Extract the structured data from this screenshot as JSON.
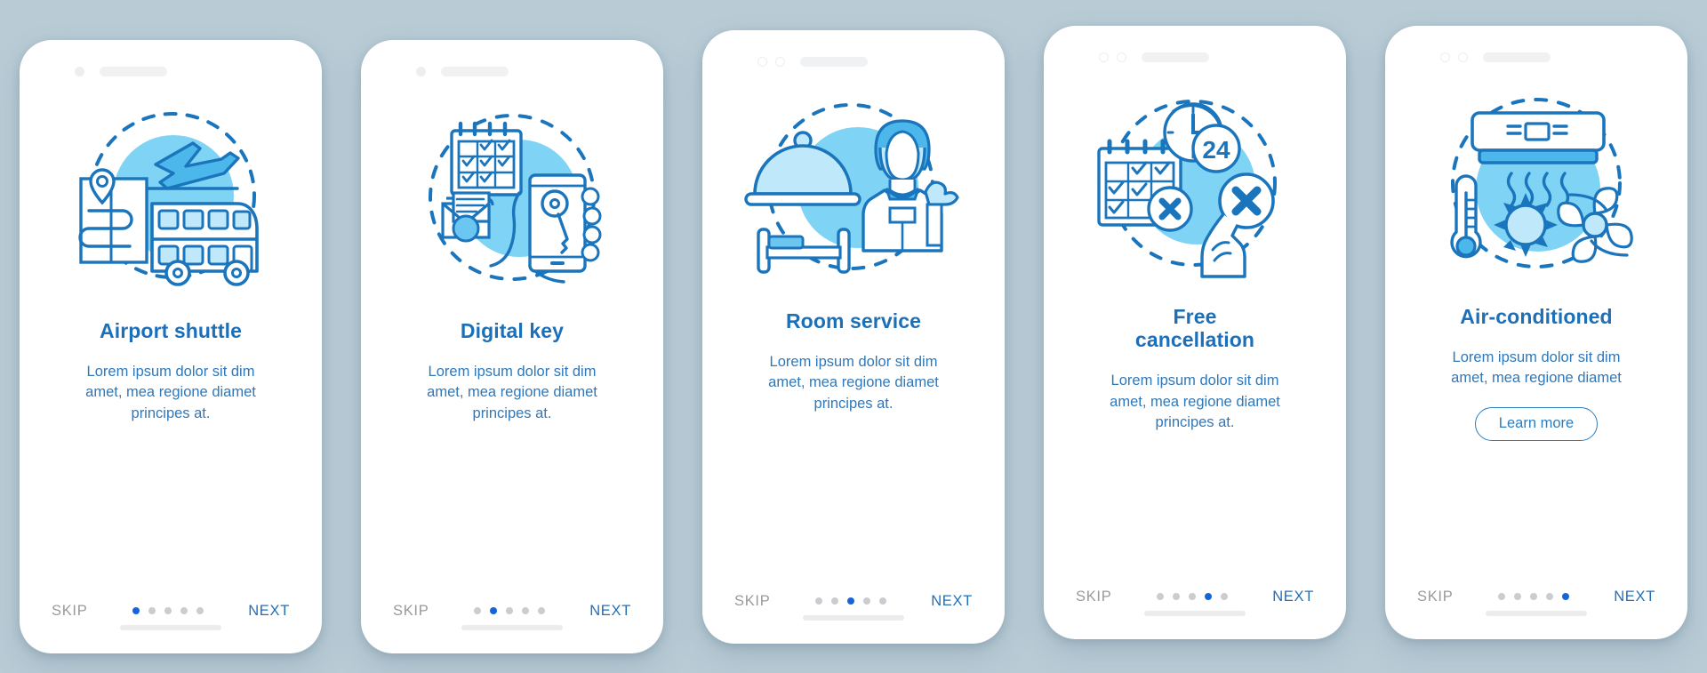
{
  "background_color": "#b9ccd6",
  "theme": {
    "title_color": "#1d6fb8",
    "desc_color": "#2f78b9",
    "next_color": "#1f6fbb",
    "skip_color": "#9a9a9a",
    "active_dot_color": "#1565d8",
    "inactive_dot_color": "#c9ccd0",
    "icon_blue": "#1b75bc",
    "icon_light_blue": "#7fd4f5",
    "icon_pale_blue": "#bfe9fb"
  },
  "common": {
    "skip_label": "SKIP",
    "next_label": "NEXT",
    "description": "Lorem ipsum dolor sit dim\namet, mea regione diamet\nprincipes at.",
    "total_steps": 5
  },
  "screens": [
    {
      "id": "airport-shuttle",
      "title": "Airport shuttle",
      "description": "Lorem ipsum dolor sit dim\namet, mea regione diamet\nprincipes at.",
      "icon_name": "airport-shuttle-icon",
      "skip_label": "SKIP",
      "next_label": "NEXT",
      "active_step": 1,
      "statusbar_style": "dot-pill",
      "has_learn_more": false
    },
    {
      "id": "digital-key",
      "title": "Digital key",
      "description": "Lorem ipsum dolor sit dim\namet, mea regione diamet\nprincipes at.",
      "icon_name": "digital-key-icon",
      "skip_label": "SKIP",
      "next_label": "NEXT",
      "active_step": 2,
      "statusbar_style": "dot-pill",
      "has_learn_more": false
    },
    {
      "id": "room-service",
      "title": "Room service",
      "description": "Lorem ipsum dolor sit dim\namet, mea regione diamet\nprincipes at.",
      "icon_name": "room-service-icon",
      "skip_label": "SKIP",
      "next_label": "NEXT",
      "active_step": 3,
      "statusbar_style": "rings-pill",
      "has_learn_more": false
    },
    {
      "id": "free-cancellation",
      "title": "Free\ncancellation",
      "description": "Lorem ipsum dolor sit dim\namet, mea regione diamet\nprincipes at.",
      "icon_name": "free-cancellation-icon",
      "skip_label": "SKIP",
      "next_label": "NEXT",
      "active_step": 4,
      "statusbar_style": "rings-pill",
      "has_learn_more": false
    },
    {
      "id": "air-conditioned",
      "title": "Air-conditioned",
      "description": "Lorem ipsum dolor sit dim\namet, mea regione diamet",
      "icon_name": "air-conditioned-icon",
      "skip_label": "SKIP",
      "next_label": "NEXT",
      "active_step": 5,
      "statusbar_style": "rings-pill",
      "has_learn_more": true,
      "learn_more_label": "Learn more"
    }
  ]
}
